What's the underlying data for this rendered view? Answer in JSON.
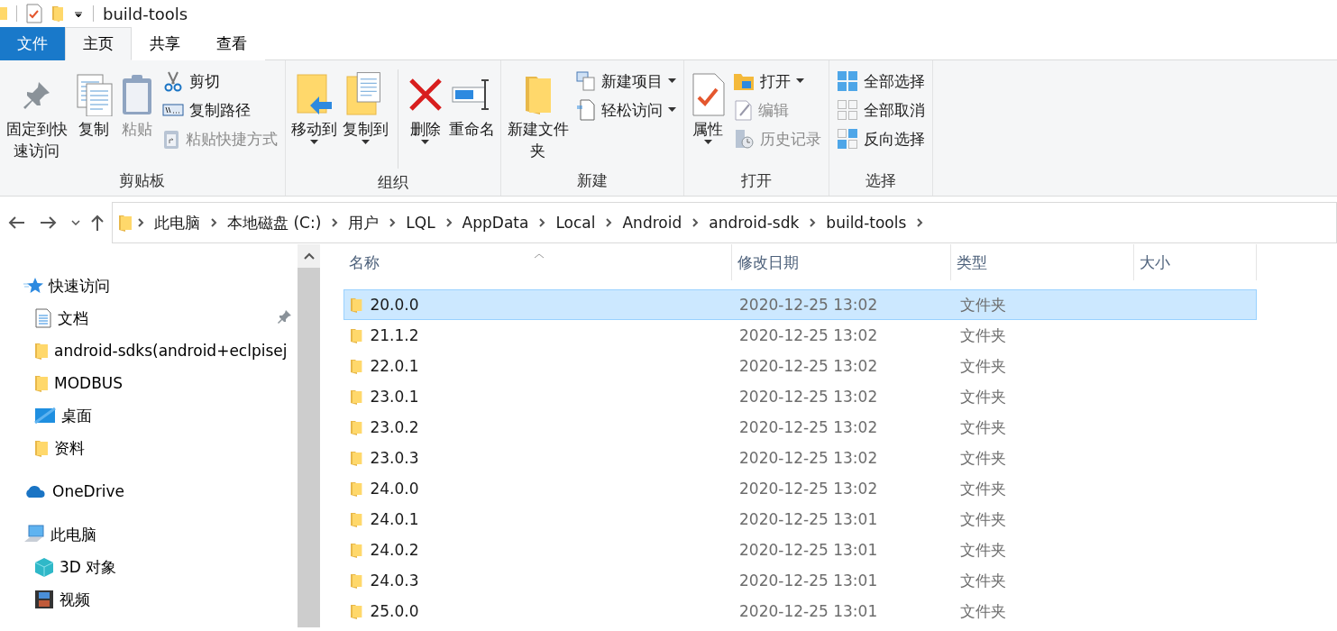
{
  "window": {
    "title": "build-tools"
  },
  "tabs": [
    {
      "label": "文件",
      "kind": "file",
      "selected": false
    },
    {
      "label": "主页",
      "kind": "tab",
      "selected": true
    },
    {
      "label": "共享",
      "kind": "tab",
      "selected": false
    },
    {
      "label": "查看",
      "kind": "tab",
      "selected": false
    }
  ],
  "ribbon": {
    "groups": [
      {
        "label": "剪贴板",
        "items": [
          {
            "kind": "large",
            "label": "固定到快速访问",
            "disabled": false,
            "dropdown": false
          },
          {
            "kind": "large",
            "label": "复制",
            "disabled": false,
            "dropdown": false
          },
          {
            "kind": "large",
            "label": "粘贴",
            "disabled": true,
            "dropdown": false
          },
          {
            "kind": "small",
            "label": "剪切",
            "disabled": false,
            "dropdown": false
          },
          {
            "kind": "small",
            "label": "复制路径",
            "disabled": false,
            "dropdown": false
          },
          {
            "kind": "small",
            "label": "粘贴快捷方式",
            "disabled": true,
            "dropdown": false
          }
        ]
      },
      {
        "label": "组织",
        "items": [
          {
            "kind": "large",
            "label": "移动到",
            "disabled": false,
            "dropdown": true
          },
          {
            "kind": "large",
            "label": "复制到",
            "disabled": false,
            "dropdown": true
          },
          {
            "kind": "separator"
          },
          {
            "kind": "large",
            "label": "删除",
            "disabled": false,
            "dropdown": true
          },
          {
            "kind": "large",
            "label": "重命名",
            "disabled": false,
            "dropdown": false
          }
        ]
      },
      {
        "label": "新建",
        "items": [
          {
            "kind": "large",
            "label": "新建文件夹",
            "disabled": false,
            "dropdown": false
          },
          {
            "kind": "small",
            "label": "新建项目",
            "disabled": false,
            "dropdown": true
          },
          {
            "kind": "small",
            "label": "轻松访问",
            "disabled": false,
            "dropdown": true
          }
        ]
      },
      {
        "label": "打开",
        "items": [
          {
            "kind": "large",
            "label": "属性",
            "disabled": false,
            "dropdown": true
          },
          {
            "kind": "small",
            "label": "打开",
            "disabled": false,
            "dropdown": true
          },
          {
            "kind": "small",
            "label": "编辑",
            "disabled": true,
            "dropdown": false
          },
          {
            "kind": "small",
            "label": "历史记录",
            "disabled": true,
            "dropdown": false
          }
        ]
      },
      {
        "label": "选择",
        "items": [
          {
            "kind": "small",
            "label": "全部选择",
            "disabled": false,
            "dropdown": false
          },
          {
            "kind": "small",
            "label": "全部取消",
            "disabled": false,
            "dropdown": false
          },
          {
            "kind": "small",
            "label": "反向选择",
            "disabled": false,
            "dropdown": false
          }
        ]
      }
    ]
  },
  "address_bar": {
    "path": [
      "此电脑",
      "本地磁盘 (C:)",
      "用户",
      "LQL",
      "AppData",
      "Local",
      "Android",
      "android-sdk",
      "build-tools"
    ]
  },
  "sidebar": {
    "items": [
      {
        "label": "快速访问",
        "kind": "star",
        "children": [
          {
            "label": "文档",
            "kind": "document",
            "pinned": true
          },
          {
            "label": "android-sdks(android+eclpisej",
            "kind": "folder",
            "pinned": false
          },
          {
            "label": "MODBUS",
            "kind": "folder",
            "pinned": false
          },
          {
            "label": "桌面",
            "kind": "desktop",
            "pinned": false
          },
          {
            "label": "资料",
            "kind": "folder",
            "pinned": false
          }
        ]
      },
      {
        "label": "OneDrive",
        "kind": "cloud"
      },
      {
        "label": "此电脑",
        "kind": "computer",
        "children": [
          {
            "label": "3D 对象",
            "kind": "cube",
            "pinned": false
          },
          {
            "label": "视频",
            "kind": "video",
            "pinned": false
          }
        ]
      }
    ]
  },
  "table": {
    "columns": [
      "名称",
      "修改日期",
      "类型",
      "大小"
    ],
    "rows": [
      {
        "name": "20.0.0",
        "modified": "2020-12-25 13:02",
        "type": "文件夹",
        "selected": true
      },
      {
        "name": "21.1.2",
        "modified": "2020-12-25 13:02",
        "type": "文件夹",
        "selected": false
      },
      {
        "name": "22.0.1",
        "modified": "2020-12-25 13:02",
        "type": "文件夹",
        "selected": false
      },
      {
        "name": "23.0.1",
        "modified": "2020-12-25 13:02",
        "type": "文件夹",
        "selected": false
      },
      {
        "name": "23.0.2",
        "modified": "2020-12-25 13:02",
        "type": "文件夹",
        "selected": false
      },
      {
        "name": "23.0.3",
        "modified": "2020-12-25 13:02",
        "type": "文件夹",
        "selected": false
      },
      {
        "name": "24.0.0",
        "modified": "2020-12-25 13:02",
        "type": "文件夹",
        "selected": false
      },
      {
        "name": "24.0.1",
        "modified": "2020-12-25 13:01",
        "type": "文件夹",
        "selected": false
      },
      {
        "name": "24.0.2",
        "modified": "2020-12-25 13:01",
        "type": "文件夹",
        "selected": false
      },
      {
        "name": "24.0.3",
        "modified": "2020-12-25 13:01",
        "type": "文件夹",
        "selected": false
      },
      {
        "name": "25.0.0",
        "modified": "2020-12-25 13:01",
        "type": "文件夹",
        "selected": false
      }
    ]
  }
}
